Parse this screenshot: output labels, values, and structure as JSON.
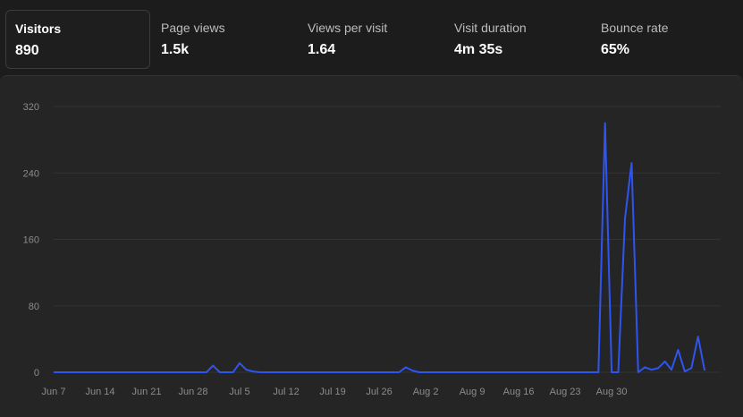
{
  "metrics": [
    {
      "label": "Visitors",
      "value": "890"
    },
    {
      "label": "Page views",
      "value": "1.5k"
    },
    {
      "label": "Views per visit",
      "value": "1.64"
    },
    {
      "label": "Visit duration",
      "value": "4m 35s"
    },
    {
      "label": "Bounce rate",
      "value": "65%"
    }
  ],
  "colors": {
    "line": "#2f55f0",
    "active_border": "#3c3c3c"
  },
  "chart_data": {
    "type": "line",
    "title": "",
    "xlabel": "",
    "ylabel": "",
    "ylim": [
      0,
      320
    ],
    "y_ticks": [
      "0",
      "80",
      "160",
      "240",
      "320"
    ],
    "x_ticks": [
      "Jun 7",
      "Jun 14",
      "Jun 21",
      "Jun 28",
      "Jul 5",
      "Jul 12",
      "Jul 19",
      "Jul 26",
      "Aug 2",
      "Aug 9",
      "Aug 16",
      "Aug 23",
      "Aug 30"
    ],
    "grid": true,
    "series": [
      {
        "name": "",
        "start_date": "Jun 7",
        "values": [
          0,
          0,
          0,
          0,
          0,
          0,
          0,
          0,
          0,
          0,
          0,
          0,
          0,
          0,
          0,
          0,
          0,
          0,
          0,
          0,
          0,
          0,
          0,
          0,
          8,
          0,
          0,
          0,
          11,
          3,
          1,
          0,
          0,
          0,
          0,
          0,
          0,
          0,
          0,
          0,
          0,
          0,
          0,
          0,
          0,
          0,
          0,
          0,
          0,
          0,
          0,
          0,
          0,
          0,
          0,
          0,
          0,
          0,
          0,
          0,
          0,
          0,
          0,
          0,
          0,
          0,
          0,
          0,
          0,
          0,
          0,
          0,
          0,
          0,
          0,
          0,
          0,
          0,
          0,
          0,
          0,
          0,
          0,
          0,
          0,
          0,
          0,
          0,
          0,
          0,
          0,
          0,
          0,
          0,
          0,
          0,
          0,
          0,
          0,
          0,
          0,
          0,
          0,
          0,
          0,
          0,
          0,
          0,
          0,
          0,
          0,
          0,
          0,
          0,
          0,
          0,
          0,
          0,
          0,
          0,
          0,
          0,
          0,
          0,
          0,
          0,
          0,
          0,
          0,
          0,
          0,
          0,
          0,
          0,
          0,
          0,
          0,
          0,
          0,
          0,
          0,
          0,
          0,
          0,
          0,
          0,
          0,
          0,
          0,
          0,
          0,
          0,
          0,
          0,
          0,
          0,
          0,
          0,
          0,
          0,
          0,
          0,
          0,
          0,
          0,
          0,
          0,
          0,
          0,
          0,
          0,
          0,
          0,
          0,
          0,
          0,
          0,
          0,
          0,
          0,
          0,
          0,
          0,
          0,
          0,
          0,
          0,
          0,
          0,
          0,
          0,
          0,
          0,
          0,
          0,
          0,
          0,
          0,
          0,
          0,
          0,
          0,
          0,
          0,
          0,
          0,
          0,
          0,
          0,
          0,
          0,
          0,
          0,
          0,
          0,
          0,
          0,
          0,
          0,
          0,
          0,
          0,
          0,
          0,
          0,
          0,
          0,
          0,
          0,
          0,
          0,
          0,
          0,
          0,
          0,
          0,
          0,
          0,
          0,
          0,
          0,
          0,
          0,
          0,
          0,
          0,
          0,
          0,
          0,
          0,
          0,
          0,
          0,
          0,
          0,
          0,
          0,
          0,
          0,
          0,
          0,
          0,
          0,
          0,
          0,
          0,
          0
        ]
      }
    ]
  }
}
